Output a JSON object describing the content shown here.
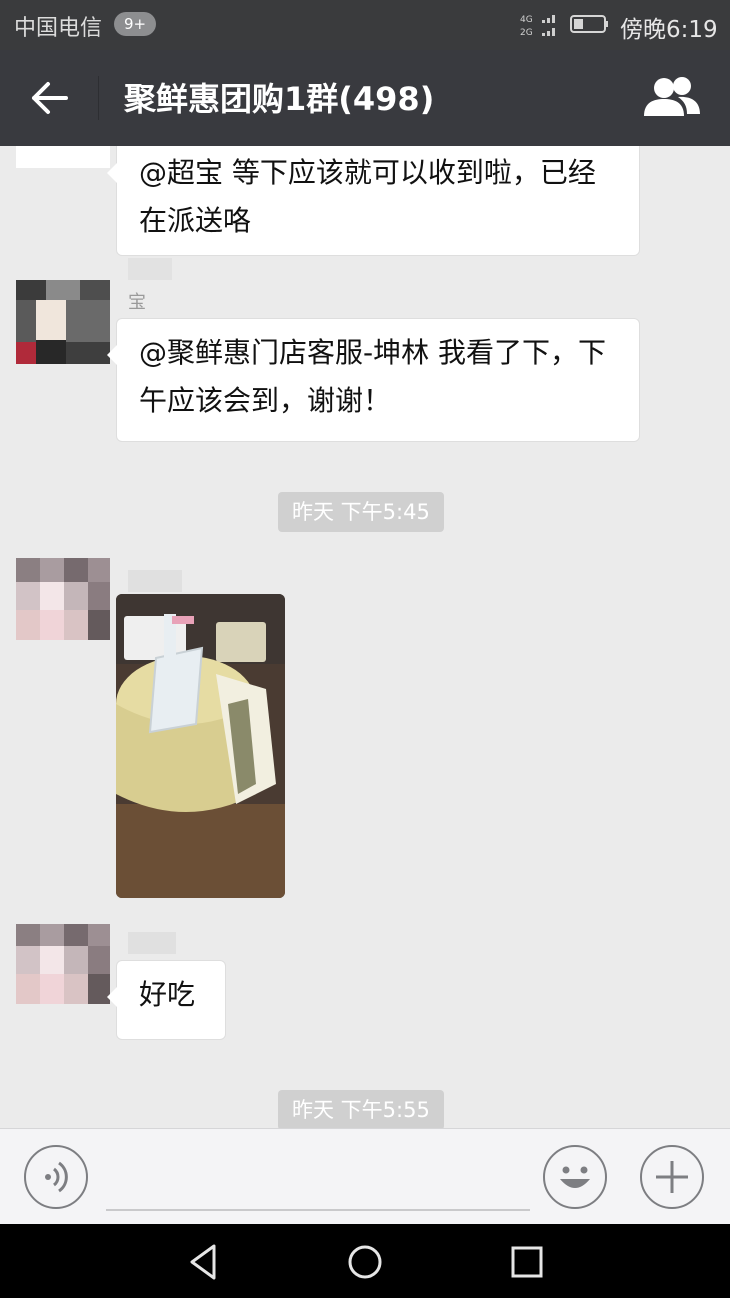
{
  "status_bar": {
    "carrier": "中国电信",
    "notification_count": "9+",
    "network_top": "4G",
    "network_bottom": "2G",
    "time": "傍晚6:19"
  },
  "header": {
    "title": "聚鲜惠团购1群(498)",
    "back_icon": "arrow-left-icon",
    "members_icon": "group-members-icon"
  },
  "messages": [
    {
      "type": "text",
      "text": "@超宝 等下应该就可以收到啦，已经在派送咯"
    },
    {
      "type": "text",
      "sender_nick": "宝",
      "text": "@聚鲜惠门店客服-坤林  我看了下，下午应该会到，谢谢！"
    },
    {
      "type": "timestamp",
      "text": "昨天 下午5:45"
    },
    {
      "type": "image",
      "alt": "cake photo"
    },
    {
      "type": "text",
      "text": "好吃"
    },
    {
      "type": "timestamp",
      "text": "昨天 下午5:55"
    }
  ],
  "input_bar": {
    "voice_icon": "voice-icon",
    "emoji_icon": "emoji-icon",
    "plus_icon": "plus-icon",
    "input_value": "",
    "input_placeholder": ""
  },
  "nav": {
    "back": "triangle-back-icon",
    "home": "circle-home-icon",
    "recents": "square-recents-icon"
  },
  "colors": {
    "title_bar": "#393a3f",
    "status_bar": "#3a3b3d",
    "chat_background": "#ebebeb",
    "bubble": "#ffffff",
    "timestamp_pill": "#d0d0d0"
  }
}
